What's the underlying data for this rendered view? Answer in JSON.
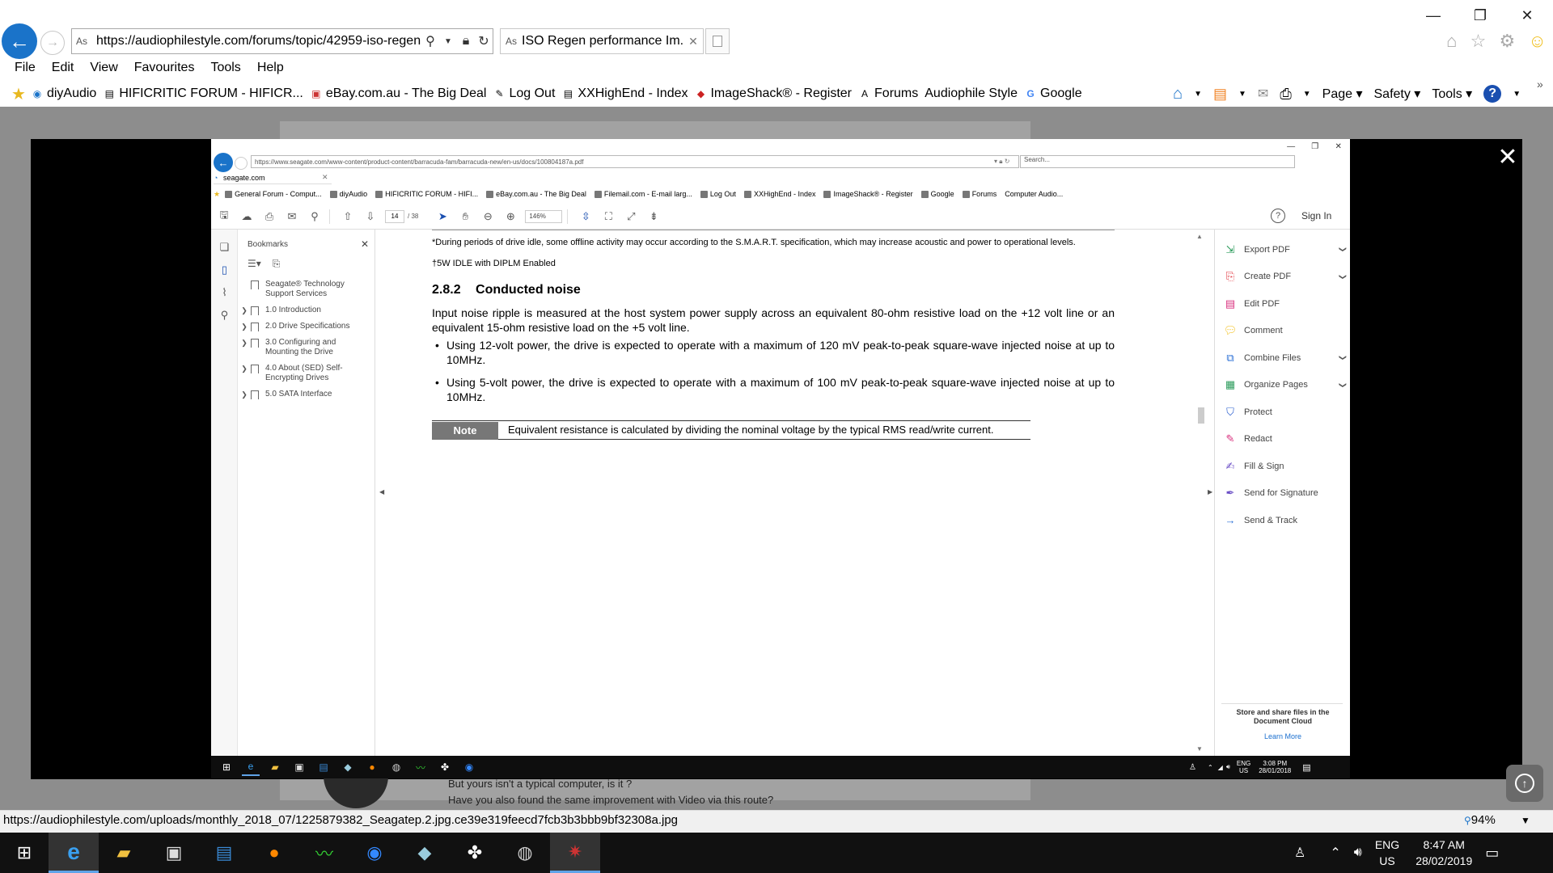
{
  "browser": {
    "url": "https://audiophilestyle.com/forums/topic/42959-iso-regen",
    "tab_title": "ISO Regen performance Im...",
    "site_icon": "As",
    "menu": [
      "File",
      "Edit",
      "View",
      "Favourites",
      "Tools",
      "Help"
    ],
    "favourites": [
      {
        "label": "diyAudio",
        "icon": "globe-icon"
      },
      {
        "label": "HIFICRITIC FORUM - HIFICR...",
        "icon": "page-icon"
      },
      {
        "label": "eBay.com.au - The Big Deal",
        "icon": "shopping-bag-icon"
      },
      {
        "label": "Log Out",
        "icon": "feather-icon"
      },
      {
        "label": "XXHighEnd - Index",
        "icon": "page-icon"
      },
      {
        "label": "ImageShack® - Register",
        "icon": "imageshack-icon"
      },
      {
        "label": "Forums",
        "icon": "as-icon"
      },
      {
        "label": "Audiophile Style",
        "icon": "none"
      },
      {
        "label": "Google",
        "icon": "google-icon"
      }
    ],
    "commands": [
      "Page",
      "Safety",
      "Tools"
    ],
    "status_url": "https://audiophilestyle.com/uploads/monthly_2018_07/1225879382_Seagatep.2.jpg.ce39e319feecd7fcb3b3bbb9bf32308a.jpg",
    "zoom": "94%"
  },
  "forum": {
    "line1": "But yours isn't a typical computer, is it ?",
    "line2": "Have you also found the same improvement with Video via this route?"
  },
  "inner_browser": {
    "url": "https://www.seagate.com/www-content/product-content/barracuda-fam/barracuda-new/en-us/docs/100804187a.pdf",
    "search_placeholder": "Search...",
    "tab_title": "seagate.com",
    "favourites": [
      "General Forum - Comput...",
      "diyAudio",
      "HIFICRITIC FORUM - HIFI...",
      "eBay.com.au - The Big Deal",
      "Filemail.com - E-mail larg...",
      "Log Out",
      "XXHighEnd - Index",
      "ImageShack® - Register",
      "Google",
      "Forums",
      "Computer Audio..."
    ]
  },
  "acrobat": {
    "page_current": "14",
    "page_total": "/ 38",
    "zoom": "146%",
    "sign_in": "Sign In",
    "bookmarks_title": "Bookmarks",
    "bookmarks": [
      {
        "label": "Seagate® Technology Support Services",
        "expandable": false
      },
      {
        "label": "1.0 Introduction",
        "expandable": true
      },
      {
        "label": "2.0 Drive Specifications",
        "expandable": true
      },
      {
        "label": "3.0 Configuring and Mounting the Drive",
        "expandable": true
      },
      {
        "label": "4.0 About (SED) Self-Encrypting Drives",
        "expandable": true
      },
      {
        "label": "5.0 SATA Interface",
        "expandable": true
      }
    ],
    "tools": [
      {
        "label": "Export PDF",
        "icon": "export-pdf-icon",
        "color": "#2b9b5b",
        "chevron": true
      },
      {
        "label": "Create PDF",
        "icon": "create-pdf-icon",
        "color": "#e0303a",
        "chevron": true
      },
      {
        "label": "Edit PDF",
        "icon": "edit-pdf-icon",
        "color": "#d9307e",
        "chevron": false
      },
      {
        "label": "Comment",
        "icon": "comment-icon",
        "color": "#f2c01c",
        "chevron": false
      },
      {
        "label": "Combine Files",
        "icon": "combine-files-icon",
        "color": "#2a6fd6",
        "chevron": true
      },
      {
        "label": "Organize Pages",
        "icon": "organize-pages-icon",
        "color": "#2b9b5b",
        "chevron": true
      },
      {
        "label": "Protect",
        "icon": "protect-icon",
        "color": "#2a5fcf",
        "chevron": false
      },
      {
        "label": "Redact",
        "icon": "redact-icon",
        "color": "#d9307e",
        "chevron": false
      },
      {
        "label": "Fill & Sign",
        "icon": "fill-sign-icon",
        "color": "#6b4fc6",
        "chevron": false
      },
      {
        "label": "Send for Signature",
        "icon": "send-signature-icon",
        "color": "#6b4fc6",
        "chevron": false
      },
      {
        "label": "Send & Track",
        "icon": "send-track-icon",
        "color": "#2a6fd6",
        "chevron": false
      }
    ],
    "cloud_text": "Store and share files in the Document Cloud",
    "learn_more": "Learn More"
  },
  "document": {
    "footnote1": "*During periods of drive idle, some offline activity may occur according to the S.M.A.R.T. specification, which may increase acoustic and power to operational levels.",
    "footnote2": "†5W IDLE with DIPLM Enabled",
    "section_number": "2.8.2",
    "section_title": "Conducted noise",
    "paragraph": "Input noise ripple is measured at the host system power supply across an equivalent 80-ohm resistive load on the +12 volt line or an equivalent 15-ohm resistive load on the +5 volt line.",
    "bullets": [
      "Using 12-volt power, the drive is expected to operate with a maximum of 120 mV peak-to-peak square-wave injected noise at up to 10MHz.",
      "Using 5-volt power, the drive is expected to operate with a maximum of 100 mV peak-to-peak square-wave injected noise at up to 10MHz."
    ],
    "note_label": "Note",
    "note_text": "Equivalent resistance is calculated by dividing the nominal voltage by the typical RMS read/write current."
  },
  "inner_taskbar": {
    "lang_top": "ENG",
    "lang_bottom": "US",
    "time": "3:08 PM",
    "date": "28/01/2018"
  },
  "taskbar": {
    "lang_top": "ENG",
    "lang_bottom": "US",
    "time": "8:47 AM",
    "date": "28/02/2019"
  }
}
